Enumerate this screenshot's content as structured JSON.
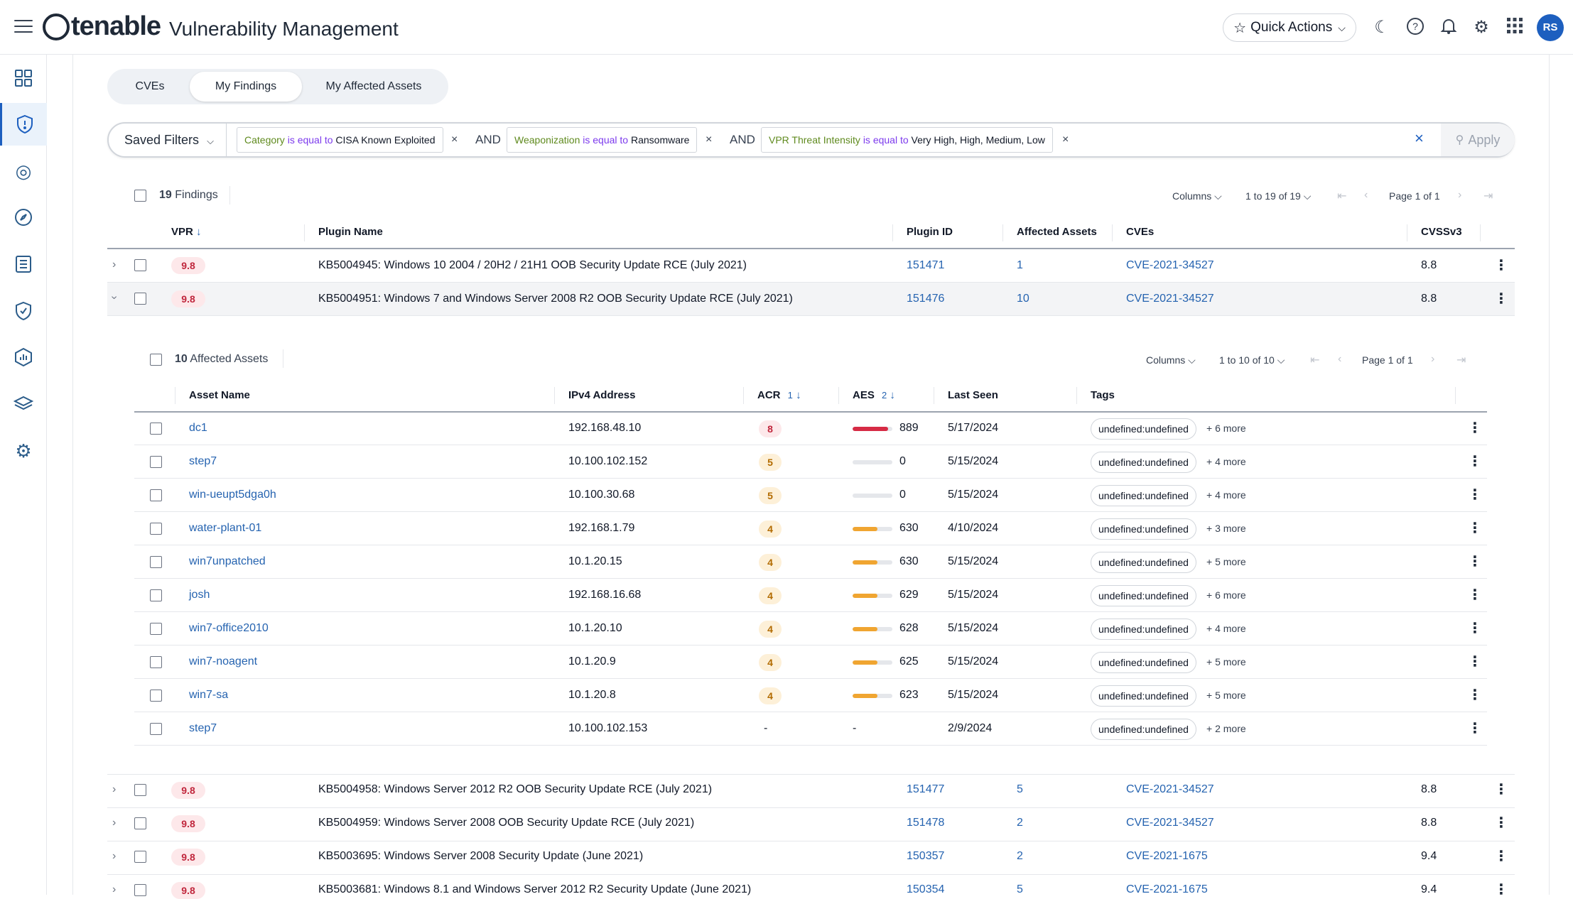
{
  "app": {
    "brand": "tenable",
    "product": "Vulnerability Management",
    "user_initials": "RS"
  },
  "header": {
    "quick_actions": "Quick Actions"
  },
  "icons": {
    "menu": "hamburger-icon",
    "theme": "moon-icon",
    "help": "help-icon",
    "notifications": "bell-icon",
    "settings": "gear-icon",
    "apps": "grid-icon"
  },
  "tabs": [
    {
      "label": "CVEs",
      "active": false
    },
    {
      "label": "My Findings",
      "active": true
    },
    {
      "label": "My Affected Assets",
      "active": false
    }
  ],
  "filters": {
    "saved_label": "Saved Filters",
    "and": "AND",
    "apply": "Apply",
    "items": [
      {
        "key": "Category",
        "op": "is equal to",
        "value": "CISA Known Exploited"
      },
      {
        "key": "Weaponization",
        "op": "is equal to",
        "value": "Ransomware"
      },
      {
        "key": "VPR Threat Intensity",
        "op": "is equal to",
        "value": "Very High, High, Medium, Low"
      }
    ]
  },
  "findings": {
    "count": "19",
    "count_label": "Findings",
    "columns_label": "Columns",
    "range": "1 to 19 of 19",
    "page": "Page 1 of 1",
    "headers": {
      "vpr": "VPR",
      "plugin_name": "Plugin Name",
      "plugin_id": "Plugin ID",
      "affected_assets": "Affected Assets",
      "cves": "CVEs",
      "cvss": "CVSSv3"
    },
    "rows": [
      {
        "vpr": "9.8",
        "name": "KB5004945: Windows 10 2004 / 20H2 / 21H1 OOB Security Update RCE (July 2021)",
        "id": "151471",
        "assets": "1",
        "cve": "CVE-2021-34527",
        "cvss": "8.8"
      },
      {
        "vpr": "9.8",
        "name": "KB5004951: Windows 7 and Windows Server 2008 R2 OOB Security Update RCE (July 2021)",
        "id": "151476",
        "assets": "10",
        "cve": "CVE-2021-34527",
        "cvss": "8.8"
      },
      {
        "vpr": "9.8",
        "name": "KB5004958: Windows Server 2012 R2 OOB Security Update RCE (July 2021)",
        "id": "151477",
        "assets": "5",
        "cve": "CVE-2021-34527",
        "cvss": "8.8"
      },
      {
        "vpr": "9.8",
        "name": "KB5004959: Windows Server 2008 OOB Security Update RCE (July 2021)",
        "id": "151478",
        "assets": "2",
        "cve": "CVE-2021-34527",
        "cvss": "8.8"
      },
      {
        "vpr": "9.8",
        "name": "KB5003695: Windows Server 2008 Security Update (June 2021)",
        "id": "150357",
        "assets": "2",
        "cve": "CVE-2021-1675",
        "cvss": "9.4"
      },
      {
        "vpr": "9.8",
        "name": "KB5003681: Windows 8.1 and Windows Server 2012 R2 Security Update (June 2021)",
        "id": "150354",
        "assets": "5",
        "cve": "CVE-2021-1675",
        "cvss": "9.4"
      }
    ]
  },
  "assets": {
    "count": "10",
    "count_label": "Affected Assets",
    "columns_label": "Columns",
    "range": "1 to 10 of 10",
    "page": "Page 1 of 1",
    "headers": {
      "name": "Asset Name",
      "ip": "IPv4 Address",
      "acr": "ACR",
      "acr_sort": "1",
      "aes": "AES",
      "aes_sort": "2",
      "last_seen": "Last Seen",
      "tags": "Tags"
    },
    "rows": [
      {
        "name": "dc1",
        "ip": "192.168.48.10",
        "acr": "8",
        "aes": "889",
        "aes_pct": 0.89,
        "last_seen": "5/17/2024",
        "tag": "undefined:undefined",
        "more": "+ 6 more"
      },
      {
        "name": "step7",
        "ip": "10.100.102.152",
        "acr": "5",
        "aes": "0",
        "aes_pct": 0,
        "last_seen": "5/15/2024",
        "tag": "undefined:undefined",
        "more": "+ 4 more"
      },
      {
        "name": "win-ueupt5dga0h",
        "ip": "10.100.30.68",
        "acr": "5",
        "aes": "0",
        "aes_pct": 0,
        "last_seen": "5/15/2024",
        "tag": "undefined:undefined",
        "more": "+ 4 more"
      },
      {
        "name": "water-plant-01",
        "ip": "192.168.1.79",
        "acr": "4",
        "aes": "630",
        "aes_pct": 0.63,
        "last_seen": "4/10/2024",
        "tag": "undefined:undefined",
        "more": "+ 3 more"
      },
      {
        "name": "win7unpatched",
        "ip": "10.1.20.15",
        "acr": "4",
        "aes": "630",
        "aes_pct": 0.63,
        "last_seen": "5/15/2024",
        "tag": "undefined:undefined",
        "more": "+ 5 more"
      },
      {
        "name": "josh",
        "ip": "192.168.16.68",
        "acr": "4",
        "aes": "629",
        "aes_pct": 0.629,
        "last_seen": "5/15/2024",
        "tag": "undefined:undefined",
        "more": "+ 6 more"
      },
      {
        "name": "win7-office2010",
        "ip": "10.1.20.10",
        "acr": "4",
        "aes": "628",
        "aes_pct": 0.628,
        "last_seen": "5/15/2024",
        "tag": "undefined:undefined",
        "more": "+ 4 more"
      },
      {
        "name": "win7-noagent",
        "ip": "10.1.20.9",
        "acr": "4",
        "aes": "625",
        "aes_pct": 0.625,
        "last_seen": "5/15/2024",
        "tag": "undefined:undefined",
        "more": "+ 5 more"
      },
      {
        "name": "win7-sa",
        "ip": "10.1.20.8",
        "acr": "4",
        "aes": "623",
        "aes_pct": 0.623,
        "last_seen": "5/15/2024",
        "tag": "undefined:undefined",
        "more": "+ 5 more"
      },
      {
        "name": "step7",
        "ip": "10.100.102.153",
        "acr": "-",
        "aes": "-",
        "aes_pct": null,
        "last_seen": "2/9/2024",
        "tag": "undefined:undefined",
        "more": "+ 2 more"
      }
    ]
  },
  "colors": {
    "accent": "#1d5fbf",
    "link": "#2563b0",
    "critical": "#d62b45",
    "medium": "#f0a531",
    "vpr_bg": "#fde8ea"
  }
}
